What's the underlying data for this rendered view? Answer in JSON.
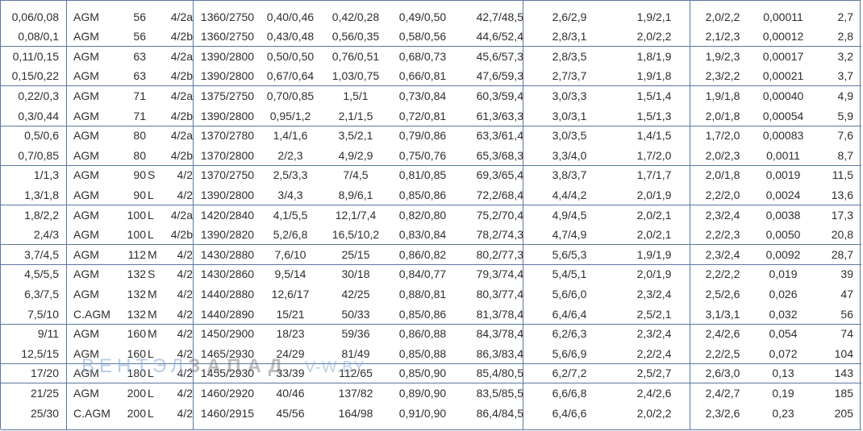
{
  "table": {
    "rows": [
      [
        "0,06/0,08",
        "AGM",
        "56",
        "",
        "4/2a",
        "1360/2750",
        "0,40/0,46",
        "0,42/0,28",
        "0,49/0,50",
        "42,7/48,5",
        "2,6/2,9",
        "1,9/2,1",
        "2,0/2,2",
        "0,00011",
        "2,7"
      ],
      [
        "0,08/0,1",
        "AGM",
        "56",
        "",
        "4/2b",
        "1360/2750",
        "0,43/0,48",
        "0,56/0,35",
        "0,58/0,56",
        "44,6/52,4",
        "2,8/3,1",
        "2,0/2,2",
        "2,1/2,3",
        "0,00012",
        "2,8"
      ],
      [
        "0,11/0,15",
        "AGM",
        "63",
        "",
        "4/2a",
        "1390/2800",
        "0,50/0,50",
        "0,76/0,51",
        "0,68/0,73",
        "45,6/57,3",
        "2,8/3,5",
        "1,8/1,9",
        "1,9/2,3",
        "0,00017",
        "3,2"
      ],
      [
        "0,15/0,22",
        "AGM",
        "63",
        "",
        "4/2b",
        "1390/2800",
        "0,67/0,64",
        "1,03/0,75",
        "0,66/0,81",
        "47,6/59,3",
        "2,7/3,7",
        "1,9/1,8",
        "2,3/2,2",
        "0,00021",
        "3,7"
      ],
      [
        "0,22/0,3",
        "AGM",
        "71",
        "",
        "4/2a",
        "1375/2750",
        "0,70/0,85",
        "1,5/1",
        "0,73/0,84",
        "60,3/59,4",
        "3,0/3,3",
        "1,5/1,4",
        "1,9/1,8",
        "0,00040",
        "4,9"
      ],
      [
        "0,3/0,44",
        "AGM",
        "71",
        "",
        "4/2b",
        "1390/2800",
        "0,95/1,2",
        "2,1/1,5",
        "0,72/0,81",
        "61,3/63,3",
        "3,0/3,1",
        "1,5/1,3",
        "2,0/1,8",
        "0,00054",
        "5,9"
      ],
      [
        "0,5/0,6",
        "AGM",
        "80",
        "",
        "4/2a",
        "1370/2780",
        "1,4/1,6",
        "3,5/2,1",
        "0,79/0,86",
        "63,3/61,4",
        "3,0/3,5",
        "1,4/1,5",
        "1,7/2,0",
        "0,00083",
        "7,6"
      ],
      [
        "0,7/0,85",
        "AGM",
        "80",
        "",
        "4/2b",
        "1370/2800",
        "2/2,3",
        "4,9/2,9",
        "0,75/0,76",
        "65,3/68,3",
        "3,3/4,0",
        "1,7/2,0",
        "2,0/2,3",
        "0,0011",
        "8,7"
      ],
      [
        "1/1,3",
        "AGM",
        "90",
        "S",
        "4/2",
        "1370/2750",
        "2,5/3,3",
        "7/4,5",
        "0,81/0,85",
        "69,3/65,4",
        "3,8/3,7",
        "1,7/1,7",
        "2,0/1,8",
        "0,0019",
        "11,5"
      ],
      [
        "1,3/1,8",
        "AGM",
        "90",
        "L",
        "4/2",
        "1390/2800",
        "3/4,3",
        "8,9/6,1",
        "0,85/0,86",
        "72,2/68,4",
        "4,4/4,2",
        "2,0/1,9",
        "2,2/2,0",
        "0,0024",
        "13,6"
      ],
      [
        "1,8/2,2",
        "AGM",
        "100",
        "L",
        "4/2a",
        "1420/2840",
        "4,1/5,5",
        "12,1/7,4",
        "0,82/0,80",
        "75,2/70,4",
        "4,9/4,5",
        "2,0/2,1",
        "2,3/2,4",
        "0,0038",
        "17,3"
      ],
      [
        "2,4/3",
        "AGM",
        "100",
        "L",
        "4/2b",
        "1390/2820",
        "5,2/6,8",
        "16,5/10,2",
        "0,83/0,84",
        "78,2/74,3",
        "4,7/4,9",
        "2,0/2,1",
        "2,2/2,3",
        "0,0050",
        "20,8"
      ],
      [
        "3,7/4,5",
        "AGM",
        "112",
        "M",
        "4/2",
        "1430/2880",
        "7,6/10",
        "25/15",
        "0,86/0,82",
        "80,2/77,3",
        "5,6/5,3",
        "1,9/1,9",
        "2,3/2,4",
        "0,0092",
        "28,7"
      ],
      [
        "4,5/5,5",
        "AGM",
        "132",
        "S",
        "4/2",
        "1430/2860",
        "9,5/14",
        "30/18",
        "0,84/0,77",
        "79,3/74,4",
        "5,4/5,1",
        "2,0/1,9",
        "2,2/2,2",
        "0,019",
        "39"
      ],
      [
        "6,3/7,5",
        "AGM",
        "132",
        "M",
        "4/2",
        "1440/2880",
        "12,6/17",
        "42/25",
        "0,88/0,81",
        "80,3/77,4",
        "5,6/6,0",
        "2,3/2,4",
        "2,5/2,6",
        "0,026",
        "47"
      ],
      [
        "7,5/10",
        "C.AGM",
        "132",
        "M",
        "4/2",
        "1440/2890",
        "15/21",
        "50/33",
        "0,85/0,86",
        "81,3/78,4",
        "6,4/6,4",
        "2,5/2,1",
        "3,1/3,1",
        "0,032",
        "56"
      ],
      [
        "9/11",
        "AGM",
        "160",
        "M",
        "4/2",
        "1450/2900",
        "18/23",
        "59/36",
        "0,86/0,88",
        "84,3/78,4",
        "6,2/6,3",
        "2,3/2,4",
        "2,4/2,6",
        "0,054",
        "74"
      ],
      [
        "12,5/15",
        "AGM",
        "160",
        "L",
        "4/2",
        "1465/2930",
        "24/29",
        "81/49",
        "0,85/0,88",
        "86,3/83,4",
        "5,6/6,9",
        "2,2/2,4",
        "2,2/2,5",
        "0,072",
        "104"
      ],
      [
        "17/20",
        "AGM",
        "180",
        "L",
        "4/2",
        "1455/2930",
        "33/39",
        "112/65",
        "0,85/0,90",
        "85,4/80,5",
        "6,2/7,2",
        "2,5/2,7",
        "2,6/3,0",
        "0,13",
        "143"
      ],
      [
        "21/25",
        "AGM",
        "200",
        "L",
        "4/2",
        "1460/2920",
        "40/46",
        "137/82",
        "0,89/0,90",
        "83,5/85,5",
        "6,6/6,8",
        "2,4/2,6",
        "2,4/2,7",
        "0,19",
        "185"
      ],
      [
        "25/30",
        "C.AGM",
        "200",
        "L",
        "4/2",
        "1460/2915",
        "45/56",
        "164/98",
        "0,91/0,90",
        "86,4/84,5",
        "6,4/6,6",
        "2,0/2,2",
        "2,3/2,6",
        "0,23",
        "205"
      ]
    ]
  },
  "watermark": {
    "part1": "ВЕНТЭЛ",
    "part2": "ЗАПАД",
    "site": "V-W.BY"
  }
}
